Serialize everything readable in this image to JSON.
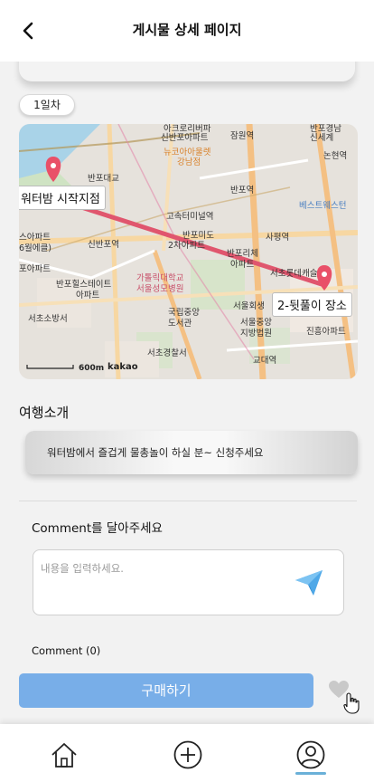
{
  "header": {
    "title": "게시물 상세 페이지"
  },
  "day_badge": "1일차",
  "map": {
    "start_marker": "워터밤 시작지점",
    "end_marker": "2-뒷풀이 장소",
    "scale_label": "600m",
    "provider": "kakao",
    "colors": {
      "route": "#e0566e",
      "marker": "#e95068"
    },
    "labels": [
      {
        "text": "아크로리버파",
        "style": "dark"
      },
      {
        "text": "신반포아파트",
        "style": "dark"
      },
      {
        "text": "잠원역",
        "style": "dark"
      },
      {
        "text": "뉴코아아울렛",
        "style": "orange"
      },
      {
        "text": "강남점",
        "style": "orange"
      },
      {
        "text": "반포대교",
        "style": "dark"
      },
      {
        "text": "반포역",
        "style": "dark"
      },
      {
        "text": "고속터미널역",
        "style": "dark"
      },
      {
        "text": "반포미도",
        "style": "dark"
      },
      {
        "text": "2차아파트",
        "style": "dark"
      },
      {
        "text": "반포리체",
        "style": "dark"
      },
      {
        "text": "아파트",
        "style": "dark"
      },
      {
        "text": "사평역",
        "style": "dark"
      },
      {
        "text": "스아파트",
        "style": "dark"
      },
      {
        "text": "6월에클)",
        "style": "dark"
      },
      {
        "text": "신반포역",
        "style": "dark"
      },
      {
        "text": "포아파트",
        "style": "dark"
      },
      {
        "text": "반포힐스테이트",
        "style": "dark"
      },
      {
        "text": "아파트",
        "style": "dark"
      },
      {
        "text": "가톨릭대학교",
        "style": "pink"
      },
      {
        "text": "서울성모병원",
        "style": "pink"
      },
      {
        "text": "국립중앙",
        "style": "dark"
      },
      {
        "text": "도서관",
        "style": "dark"
      },
      {
        "text": "서초소방서",
        "style": "dark"
      },
      {
        "text": "서초경찰서",
        "style": "dark"
      },
      {
        "text": "서울회생",
        "style": "dark"
      },
      {
        "text": "서울중앙",
        "style": "dark"
      },
      {
        "text": "지방법원",
        "style": "dark"
      },
      {
        "text": "교대역",
        "style": "dark"
      },
      {
        "text": "진흥아파트",
        "style": "dark"
      },
      {
        "text": "서초롯데캐슬",
        "style": "dark"
      },
      {
        "text": "반포경남",
        "style": "dark"
      },
      {
        "text": "신세계",
        "style": "dark"
      },
      {
        "text": "논현역",
        "style": "dark"
      },
      {
        "text": "베스트웨스턴",
        "style": "blue"
      }
    ]
  },
  "intro": {
    "title": "여행소개",
    "text": "워터밤에서 즐겁게 물총놀이 하실 분~ 신청주세요"
  },
  "comment": {
    "heading": "Comment를 달아주세요",
    "placeholder": "내용을 입력하세요.",
    "count_label": "Comment (0)"
  },
  "actions": {
    "buy_label": "구매하기"
  },
  "icons": [
    "back-arrow-icon",
    "send-paper-plane-icon",
    "heart-icon",
    "hand-cursor-icon",
    "home-icon",
    "plus-circle-icon",
    "user-profile-icon"
  ]
}
